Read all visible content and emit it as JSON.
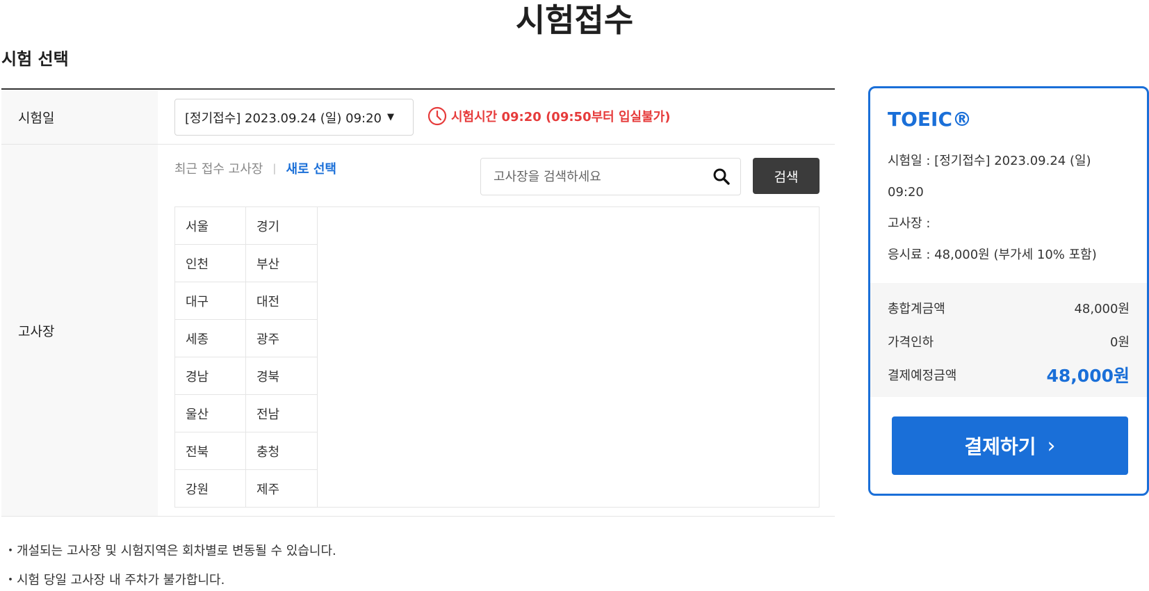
{
  "page": {
    "title": "시험접수",
    "section_title": "시험 선택"
  },
  "form": {
    "exam_date_label": "시험일",
    "exam_date_value": "[정기접수] 2023.09.24 (일) 09:20",
    "exam_time_notice": "시험시간 09:20 (09:50부터 입실불가)",
    "venue_label": "고사장",
    "tab_recent": "최근 접수 고사장",
    "tab_separator": "|",
    "tab_new": "새로 선택",
    "search_placeholder": "고사장을 검색하세요",
    "search_button": "검색",
    "regions": [
      "서울",
      "경기",
      "인천",
      "부산",
      "대구",
      "대전",
      "세종",
      "광주",
      "경남",
      "경북",
      "울산",
      "전남",
      "전북",
      "충청",
      "강원",
      "제주"
    ]
  },
  "notes": [
    "・개설되는 고사장 및 시험지역은 회차별로 변동될 수 있습니다.",
    "・시험 당일 고사장 내 주차가 불가합니다."
  ],
  "summary": {
    "exam_name": "TOEIC®",
    "exam_date_line1": "시험일 : [정기접수] 2023.09.24 (일)",
    "exam_date_line2": "09:20",
    "venue_line": "고사장 :",
    "fee_line": "응시료 : 48,000원 (부가세 10% 포함)",
    "subtotal_label": "총합계금액",
    "subtotal_value": "48,000원",
    "discount_label": "가격인하",
    "discount_value": "0원",
    "total_label": "결제예정금액",
    "total_value": "48,000원",
    "pay_button": "결제하기"
  },
  "colors": {
    "accent": "#1a6fd8",
    "warning": "#e63b3b",
    "dark_button": "#3b3b3b"
  },
  "icons": {
    "date_dropdown": "caret-down-icon",
    "exam_time": "clock-icon",
    "search": "search-icon",
    "pay": "chevron-right-icon"
  }
}
